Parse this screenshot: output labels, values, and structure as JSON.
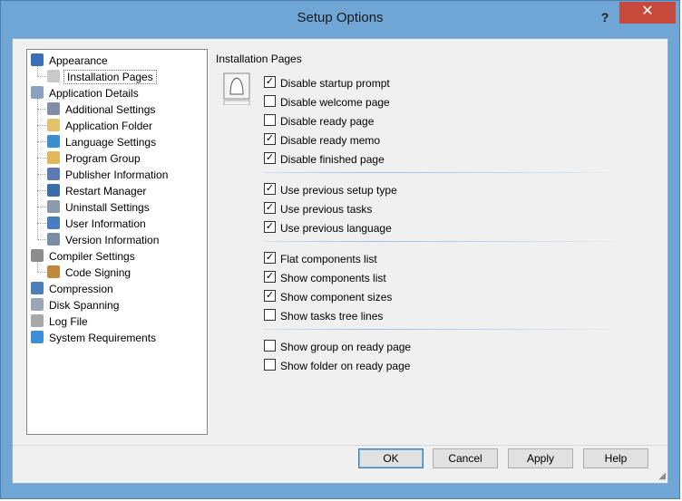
{
  "window": {
    "title": "Setup Options",
    "help_label": "?",
    "close_label": "✕"
  },
  "tree": [
    {
      "label": "Appearance",
      "icon": "monitor-icon",
      "color": "#3b6fb8"
    },
    {
      "label": "Installation Pages",
      "icon": "page-icon",
      "color": "#c9c9c9"
    },
    {
      "label": "Application Details",
      "icon": "app-icon",
      "color": "#8aa2c0"
    },
    {
      "label": "Additional Settings",
      "icon": "settings-icon",
      "color": "#7f8fa8"
    },
    {
      "label": "Application Folder",
      "icon": "folder-icon",
      "color": "#e3c26a"
    },
    {
      "label": "Language Settings",
      "icon": "globe-icon",
      "color": "#3b8fd1"
    },
    {
      "label": "Program Group",
      "icon": "group-icon",
      "color": "#e0b85a"
    },
    {
      "label": "Publisher Information",
      "icon": "publisher-icon",
      "color": "#5d7ab3"
    },
    {
      "label": "Restart Manager",
      "icon": "restart-icon",
      "color": "#3a6ea8"
    },
    {
      "label": "Uninstall Settings",
      "icon": "uninstall-icon",
      "color": "#8a9aae"
    },
    {
      "label": "User Information",
      "icon": "user-icon",
      "color": "#4c7cc0"
    },
    {
      "label": "Version Information",
      "icon": "version-icon",
      "color": "#7a8ca8"
    },
    {
      "label": "Compiler Settings",
      "icon": "gear-icon",
      "color": "#8c8c8c"
    },
    {
      "label": "Code Signing",
      "icon": "code-signing-icon",
      "color": "#c0883a"
    },
    {
      "label": "Compression",
      "icon": "compression-icon",
      "color": "#4a7fb8"
    },
    {
      "label": "Disk Spanning",
      "icon": "disk-icon",
      "color": "#9aa6b5"
    },
    {
      "label": "Log File",
      "icon": "log-icon",
      "color": "#a8a8a8"
    },
    {
      "label": "System Requirements",
      "icon": "windows-icon",
      "color": "#3d8ed8"
    }
  ],
  "panel": {
    "title": "Installation Pages",
    "groups": [
      [
        {
          "label": "Disable startup prompt",
          "checked": true
        },
        {
          "label": "Disable welcome page",
          "checked": false
        },
        {
          "label": "Disable ready page",
          "checked": false
        },
        {
          "label": "Disable ready memo",
          "checked": true
        },
        {
          "label": "Disable finished page",
          "checked": true
        }
      ],
      [
        {
          "label": "Use previous setup type",
          "checked": true
        },
        {
          "label": "Use previous tasks",
          "checked": true
        },
        {
          "label": "Use previous language",
          "checked": true
        }
      ],
      [
        {
          "label": "Flat components list",
          "checked": true
        },
        {
          "label": "Show components list",
          "checked": true
        },
        {
          "label": "Show component sizes",
          "checked": true
        },
        {
          "label": "Show tasks tree lines",
          "checked": false
        }
      ],
      [
        {
          "label": "Show group on ready page",
          "checked": false
        },
        {
          "label": "Show folder on ready page",
          "checked": false
        }
      ]
    ]
  },
  "buttons": {
    "ok": "OK",
    "cancel": "Cancel",
    "apply": "Apply",
    "help": "Help"
  }
}
